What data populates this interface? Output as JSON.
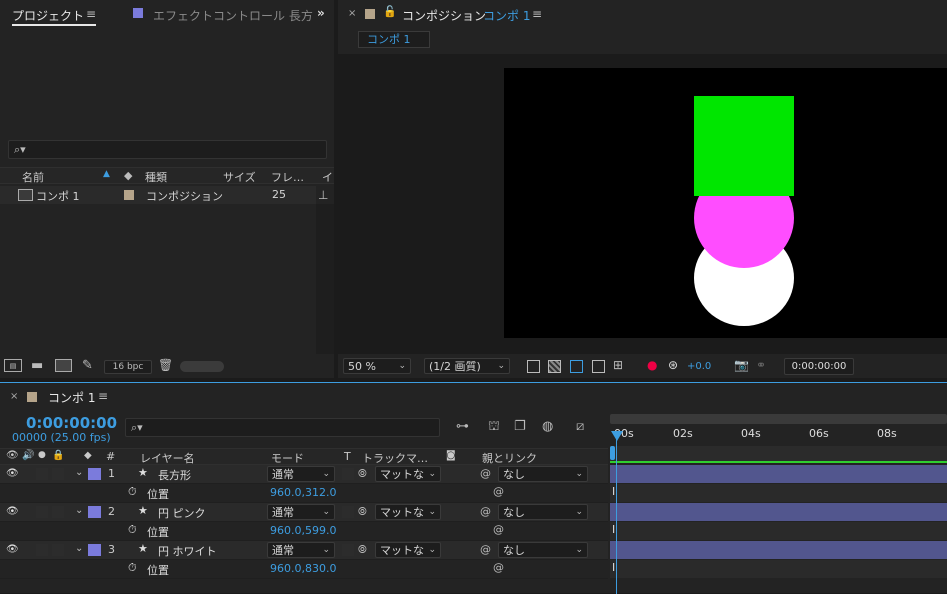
{
  "project": {
    "tab_label": "プロジェクト",
    "effect_tab_label": "エフェクトコントロール 長方",
    "search_placeholder": "",
    "columns": {
      "name": "名前",
      "type": "種類",
      "size": "サイズ",
      "frame": "フレ…",
      "extra": "イ"
    },
    "items": [
      {
        "name": "コンポ 1",
        "type": "コンポジション",
        "frame": "25"
      }
    ],
    "bpc": "16 bpc"
  },
  "composition": {
    "tab_prefix": "コンポジション",
    "tab_comp": "コンポ 1",
    "sub_tab": "コンポ 1",
    "zoom": "50 %",
    "resolution": "(1/2 画質)",
    "exposure": "+0.0",
    "timecode": "0:00:00:00",
    "shape_colors": {
      "square": "#00e600",
      "pink": "#ff4dff",
      "white": "#ffffff",
      "bg": "#000000"
    }
  },
  "timeline": {
    "tab_label": "コンポ 1",
    "timecode": "0:00:00:00",
    "frames": "00000 (25.00 fps)",
    "columns": {
      "num": "#",
      "layer_name": "レイヤー名",
      "mode": "モード",
      "t": "T",
      "track": "トラックマ…",
      "parent": "親とリンク"
    },
    "ruler": [
      "00s",
      "02s",
      "04s",
      "06s",
      "08s"
    ],
    "layers": [
      {
        "num": "1",
        "name": "長方形",
        "mode": "通常",
        "track": "マットな",
        "parent": "なし",
        "prop": "位置",
        "value": "960.0,312.0"
      },
      {
        "num": "2",
        "name": "円 ピンク",
        "mode": "通常",
        "track": "マットな",
        "parent": "なし",
        "prop": "位置",
        "value": "960.0,599.0"
      },
      {
        "num": "3",
        "name": "円 ホワイト",
        "mode": "通常",
        "track": "マットな",
        "parent": "なし",
        "prop": "位置",
        "value": "960.0,830.0"
      }
    ],
    "label_color": "#7b7bdc",
    "bar_color": "#52568e"
  }
}
